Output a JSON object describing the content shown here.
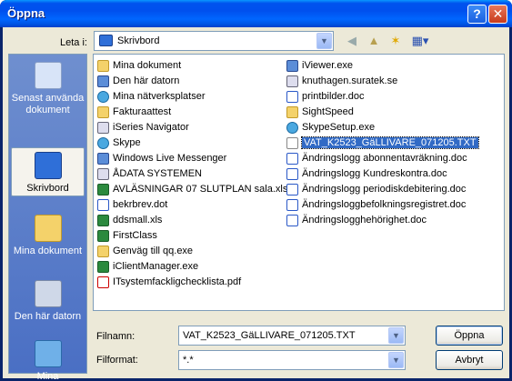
{
  "window": {
    "title": "Öppna"
  },
  "toolbar": {
    "lookin_label": "Leta i:",
    "lookin_value": "Skrivbord"
  },
  "places": [
    {
      "label": "Senast använda dokument",
      "icon": "recent-icon"
    },
    {
      "label": "Skrivbord",
      "icon": "desktop-icon"
    },
    {
      "label": "Mina dokument",
      "icon": "my-documents-icon"
    },
    {
      "label": "Den här datorn",
      "icon": "my-computer-icon"
    },
    {
      "label": "Mina nätverksplatser",
      "icon": "network-places-icon"
    }
  ],
  "files": {
    "col1": [
      {
        "name": "Mina dokument",
        "icon": "folder"
      },
      {
        "name": "Den här datorn",
        "icon": "exe"
      },
      {
        "name": "Mina nätverksplatser",
        "icon": "web"
      },
      {
        "name": "Fakturaattest",
        "icon": "folder"
      },
      {
        "name": "iSeries Navigator",
        "icon": "shortcut"
      },
      {
        "name": "Skype",
        "icon": "web"
      },
      {
        "name": "Windows Live Messenger",
        "icon": "exe"
      },
      {
        "name": "ÅDATA SYSTEMEN",
        "icon": "shortcut"
      },
      {
        "name": "AVLÄSNINGAR 07 SLUTPLAN sala.xls",
        "icon": "xls"
      },
      {
        "name": "bekrbrev.dot",
        "icon": "doc"
      },
      {
        "name": "ddsmall.xls",
        "icon": "xls"
      },
      {
        "name": "FirstClass",
        "icon": "xls"
      },
      {
        "name": "Genväg till qq.exe",
        "icon": "folder"
      },
      {
        "name": "iClientManager.exe",
        "icon": "xls"
      },
      {
        "name": "ITsystemfackligchecklista.pdf",
        "icon": "pdf"
      }
    ],
    "col2": [
      {
        "name": "iViewer.exe",
        "icon": "exe"
      },
      {
        "name": "knuthagen.suratek.se",
        "icon": "shortcut"
      },
      {
        "name": "printbilder.doc",
        "icon": "doc"
      },
      {
        "name": "SightSpeed",
        "icon": "folder"
      },
      {
        "name": "SkypeSetup.exe",
        "icon": "web"
      },
      {
        "name": "VAT_K2523_GäLLIVARE_071205.TXT",
        "icon": "txt",
        "selected": true
      },
      {
        "name": "Ändringslogg abonnentavräkning.doc",
        "icon": "doc"
      },
      {
        "name": "Ändringslogg Kundreskontra.doc",
        "icon": "doc"
      },
      {
        "name": "Ändringslogg periodiskdebitering.doc",
        "icon": "doc"
      },
      {
        "name": "Ändringsloggbefolkningsregistret.doc",
        "icon": "doc"
      },
      {
        "name": "Ändringslogghehörighet.doc",
        "icon": "doc"
      }
    ]
  },
  "bottom": {
    "filename_label": "Filnamn:",
    "filename_value": "VAT_K2523_GäLLIVARE_071205.TXT",
    "filetype_label": "Filformat:",
    "filetype_value": "*.*",
    "open_label": "Öppna",
    "cancel_label": "Avbryt"
  }
}
